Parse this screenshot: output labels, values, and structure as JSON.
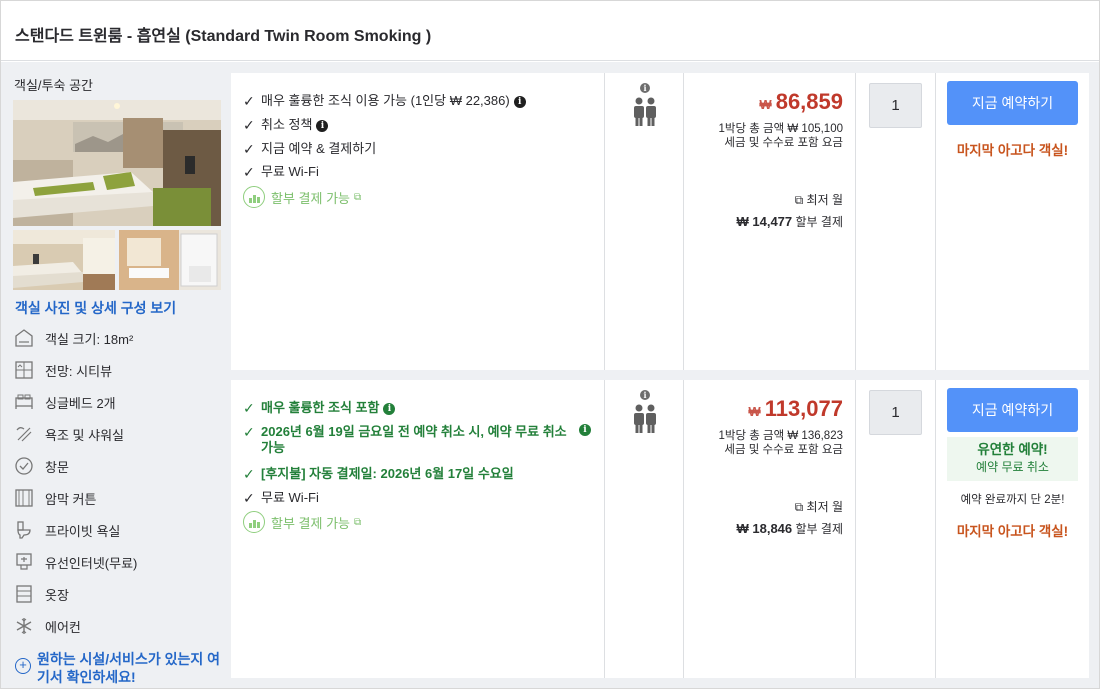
{
  "header": {
    "title": "스탠다드 트윈룸 - 흡연실 (Standard Twin Room Smoking )"
  },
  "left": {
    "section_title": "객실/투숙 공간",
    "photo_link": "객실 사진 및 상세 구성 보기",
    "amenities": [
      {
        "icon": "room-size-icon",
        "label": "객실 크기: 18m²"
      },
      {
        "icon": "view-icon",
        "label": "전망: 시티뷰"
      },
      {
        "icon": "bed-icon",
        "label": "싱글베드 2개"
      },
      {
        "icon": "shower-icon",
        "label": "욕조 및 샤워실"
      },
      {
        "icon": "window-icon",
        "label": "창문"
      },
      {
        "icon": "curtain-icon",
        "label": "암막 커튼"
      },
      {
        "icon": "toilet-icon",
        "label": "프라이빗 욕실"
      },
      {
        "icon": "wired-internet-icon",
        "label": "유선인터넷(무료)"
      },
      {
        "icon": "wardrobe-icon",
        "label": "옷장"
      },
      {
        "icon": "aircon-icon",
        "label": "에어컨"
      }
    ],
    "feature_link": "원하는 시설/서비스가 있는지 여기서 확인하세요!"
  },
  "offers": [
    {
      "features": [
        {
          "text": "매우 훌륭한 조식 이용 가능 (1인당 ₩ 22,386)",
          "info": true,
          "green": false
        },
        {
          "text": "취소 정책",
          "info": true,
          "green": false
        },
        {
          "text": "지금 예약 & 결제하기",
          "info": false,
          "green": false
        },
        {
          "text": "무료 Wi-Fi",
          "info": false,
          "green": false
        }
      ],
      "installment_label": "할부 결제 가능",
      "currency": "₩",
      "price": "86,859",
      "total_line": "1박당 총 금액 ₩ 105,100",
      "tax_line": "세금 및 수수료 포함 요금",
      "min_monthly": "최저 월",
      "monthly_amount": "₩ 14,477",
      "monthly_suffix": "할부 결제",
      "quantity": "1",
      "book_label": "지금 예약하기",
      "last_room": "마지막 아고다 객실!"
    },
    {
      "features": [
        {
          "text": "매우 훌륭한 조식 포함",
          "info": true,
          "green": true
        },
        {
          "text": "2026년 6월 19일 금요일 전 예약 취소 시, 예약 무료 취소 가능",
          "info": true,
          "green": true
        },
        {
          "text": "[후지불] 자동 결제일: 2026년 6월 17일 수요일",
          "info": false,
          "green": true
        },
        {
          "text": "무료 Wi-Fi",
          "info": false,
          "green": false
        }
      ],
      "installment_label": "할부 결제 가능",
      "currency": "₩",
      "price": "113,077",
      "total_line": "1박당 총 금액 ₩ 136,823",
      "tax_line": "세금 및 수수료 포함 요금",
      "min_monthly": "최저 월",
      "monthly_amount": "₩ 18,846",
      "monthly_suffix": "할부 결제",
      "quantity": "1",
      "book_label": "지금 예약하기",
      "flexible_title": "유연한 예약!",
      "flexible_sub": "예약 무료 취소",
      "minutes_note": "예약 완료까지 단 2분!",
      "last_room": "마지막 아고다 객실!"
    }
  ]
}
